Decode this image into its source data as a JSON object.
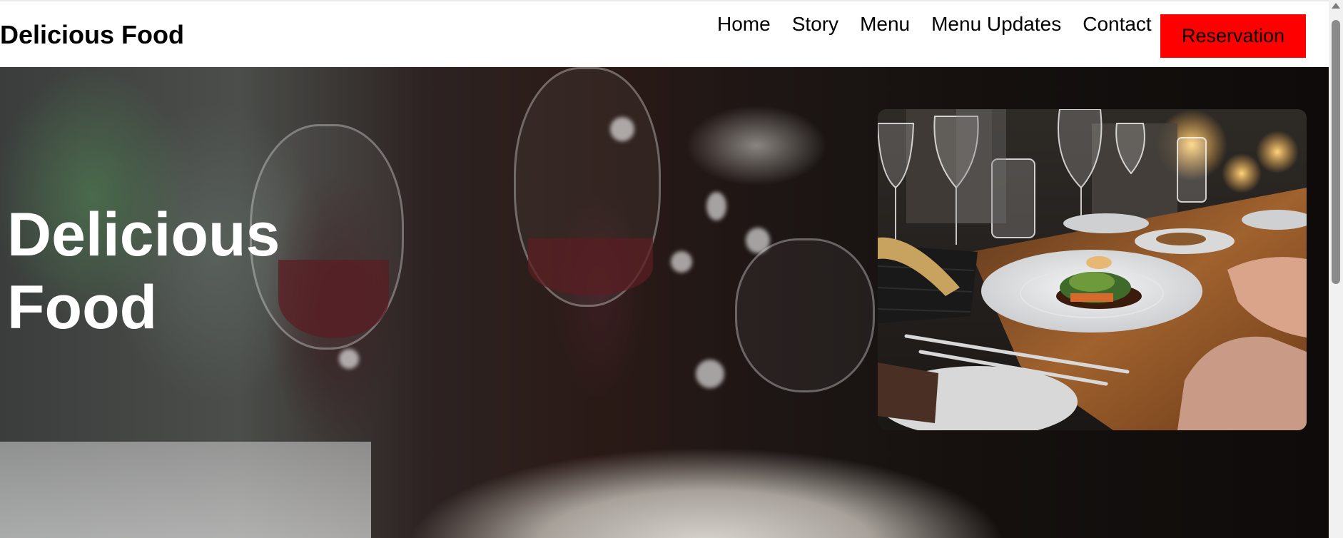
{
  "header": {
    "brand": "Delicious Food",
    "nav": [
      "Home",
      "Story",
      "Menu",
      "Menu Updates",
      "Contact"
    ],
    "reservation_label": "Reservation",
    "reservation_color": "#ff0000"
  },
  "hero": {
    "title": "Delicious\nFood"
  },
  "scrollbar": {
    "icon": "triangle-up-icon"
  }
}
